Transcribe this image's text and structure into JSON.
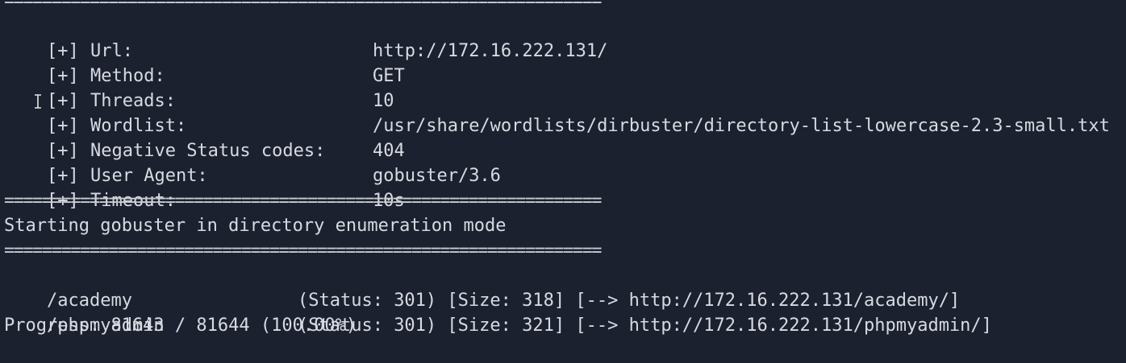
{
  "terminal": {
    "separator": "===============================================================",
    "config": [
      {
        "prefix": "[+]",
        "key": "Url:",
        "value": "http://172.16.222.131/"
      },
      {
        "prefix": "[+]",
        "key": "Method:",
        "value": "GET"
      },
      {
        "prefix": "[+]",
        "key": "Threads:",
        "value": "10"
      },
      {
        "prefix": "[+]",
        "key": "Wordlist:",
        "value": "/usr/share/wordlists/dirbuster/directory-list-lowercase-2.3-small.txt"
      },
      {
        "prefix": "[+]",
        "key": "Negative Status codes:",
        "value": "404"
      },
      {
        "prefix": "[+]",
        "key": "User Agent:",
        "value": "gobuster/3.6"
      },
      {
        "prefix": "[+]",
        "key": "Timeout:",
        "value": "10s"
      }
    ],
    "start_message": "Starting gobuster in directory enumeration mode",
    "results": [
      {
        "path": "/academy",
        "details": "(Status: 301) [Size: 318] [--> http://172.16.222.131/academy/]"
      },
      {
        "path": "/phpmyadmin",
        "details": "(Status: 301) [Size: 321] [--> http://172.16.222.131/phpmyadmin/]"
      }
    ],
    "progress": "Progress: 81643 / 81644 (100.00%)"
  }
}
